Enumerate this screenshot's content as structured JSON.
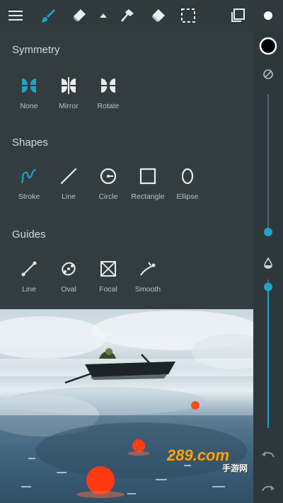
{
  "toolbar": {
    "icons": [
      "menu-icon",
      "brush-icon",
      "eraser-icon",
      "triangle-up-icon",
      "smudge-icon",
      "fill-bucket-icon",
      "selection-icon",
      "layers-icon",
      "color-dot-icon"
    ]
  },
  "panel": {
    "symmetry": {
      "title": "Symmetry",
      "items": [
        {
          "label": "None",
          "active": true
        },
        {
          "label": "Mirror",
          "active": false
        },
        {
          "label": "Rotate",
          "active": false
        }
      ]
    },
    "shapes": {
      "title": "Shapes",
      "items": [
        {
          "label": "Stroke",
          "active": true
        },
        {
          "label": "Line",
          "active": false
        },
        {
          "label": "Circle",
          "active": false
        },
        {
          "label": "Rectangle",
          "active": false
        },
        {
          "label": "Ellipse",
          "active": false
        }
      ]
    },
    "guides": {
      "title": "Guides",
      "items": [
        {
          "label": "Line",
          "active": false
        },
        {
          "label": "Oval",
          "active": false
        },
        {
          "label": "Focal",
          "active": false
        },
        {
          "label": "Smooth",
          "active": false
        }
      ]
    }
  },
  "rail": {
    "size_level": 0.35,
    "opacity_level": 0.95
  },
  "watermark": {
    "text": "289.com",
    "sub": "手游网"
  },
  "colors": {
    "accent": "#1fa3c9",
    "panel": "#333c41",
    "icon": "#e8ecee"
  }
}
